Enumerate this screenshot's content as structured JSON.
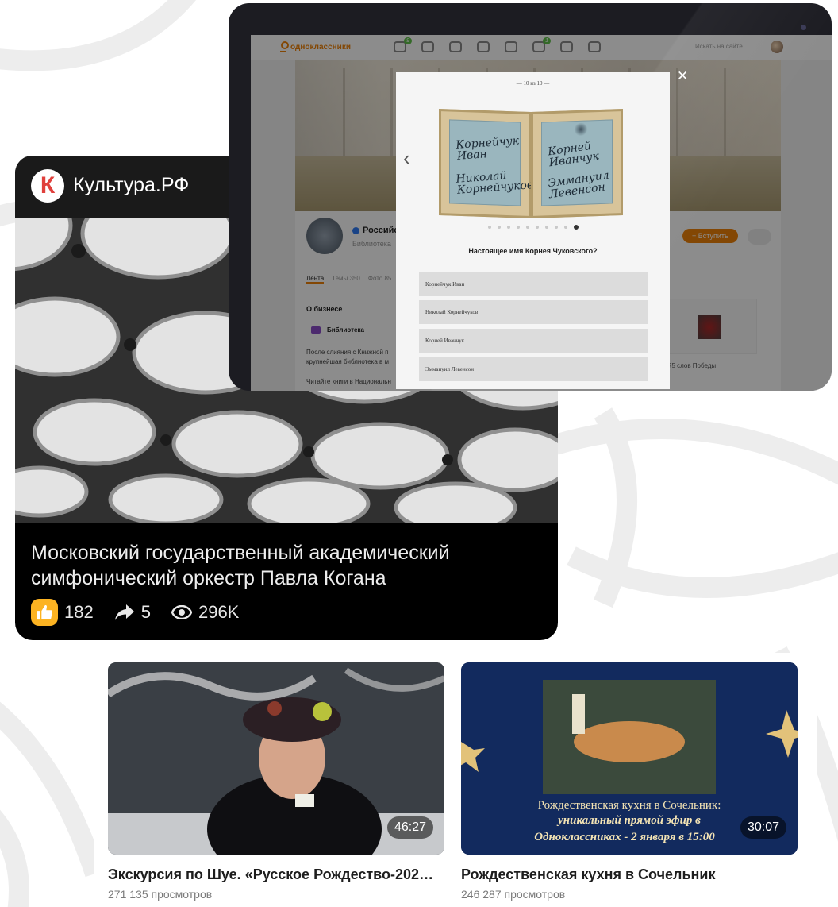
{
  "kultura": {
    "logo_letter": "К",
    "source_name": "Культура.РФ",
    "title": "Московский государственный академический симфонический оркестр Павла Когана",
    "likes": "182",
    "shares": "5",
    "views": "296K",
    "accent_color": "#fcb322"
  },
  "ok_page": {
    "logo_text": "одноклассники",
    "badge_1": "9",
    "badge_2": "1",
    "search_placeholder": "Искать на сайте",
    "group_name": "Российс",
    "group_type": "Библиотека",
    "join_label": "+ Вступить",
    "more_label": "···",
    "tabs": [
      "Лента",
      "Темы 350",
      "Фото 85"
    ],
    "about_heading": "О бизнесе",
    "category": "Библиотека",
    "text_1": "После слияния с Книжной п",
    "text_2": "крупнейшая библиотека в м",
    "text_3": "Читайте книги в Национальн",
    "right_caption": "75 слов Победы",
    "accent_color": "#ee8208"
  },
  "quiz": {
    "counter": "— 10 из 10 —",
    "book_left_1": "Корнейчук Иван",
    "book_left_2": "Николай Корнейчуков",
    "book_right_1": "Корней Иванчук",
    "book_right_2": "Эммануил Левенсон",
    "question": "Настоящее имя Корнея Чуковского?",
    "answers": [
      "Корнейчук Иван",
      "Николай Корнейчуков",
      "Корней Иванчук",
      "Эммануил Левенсон"
    ],
    "total_dots": 10,
    "active_dot": 10
  },
  "videos": [
    {
      "title": "Экскурсия по Шуе. «Русское Рождество-202…",
      "views": "271 135 просмотров",
      "duration": "46:27"
    },
    {
      "title": "Рождественская кухня в Сочельник",
      "views": "246 287 просмотров",
      "duration": "30:07",
      "overlay_line_1": "Рождественская кухня в Сочельник:",
      "overlay_line_2": "уникальный прямой эфир в",
      "overlay_line_3": "Одноклассниках - 2 января в 15:00"
    }
  ]
}
